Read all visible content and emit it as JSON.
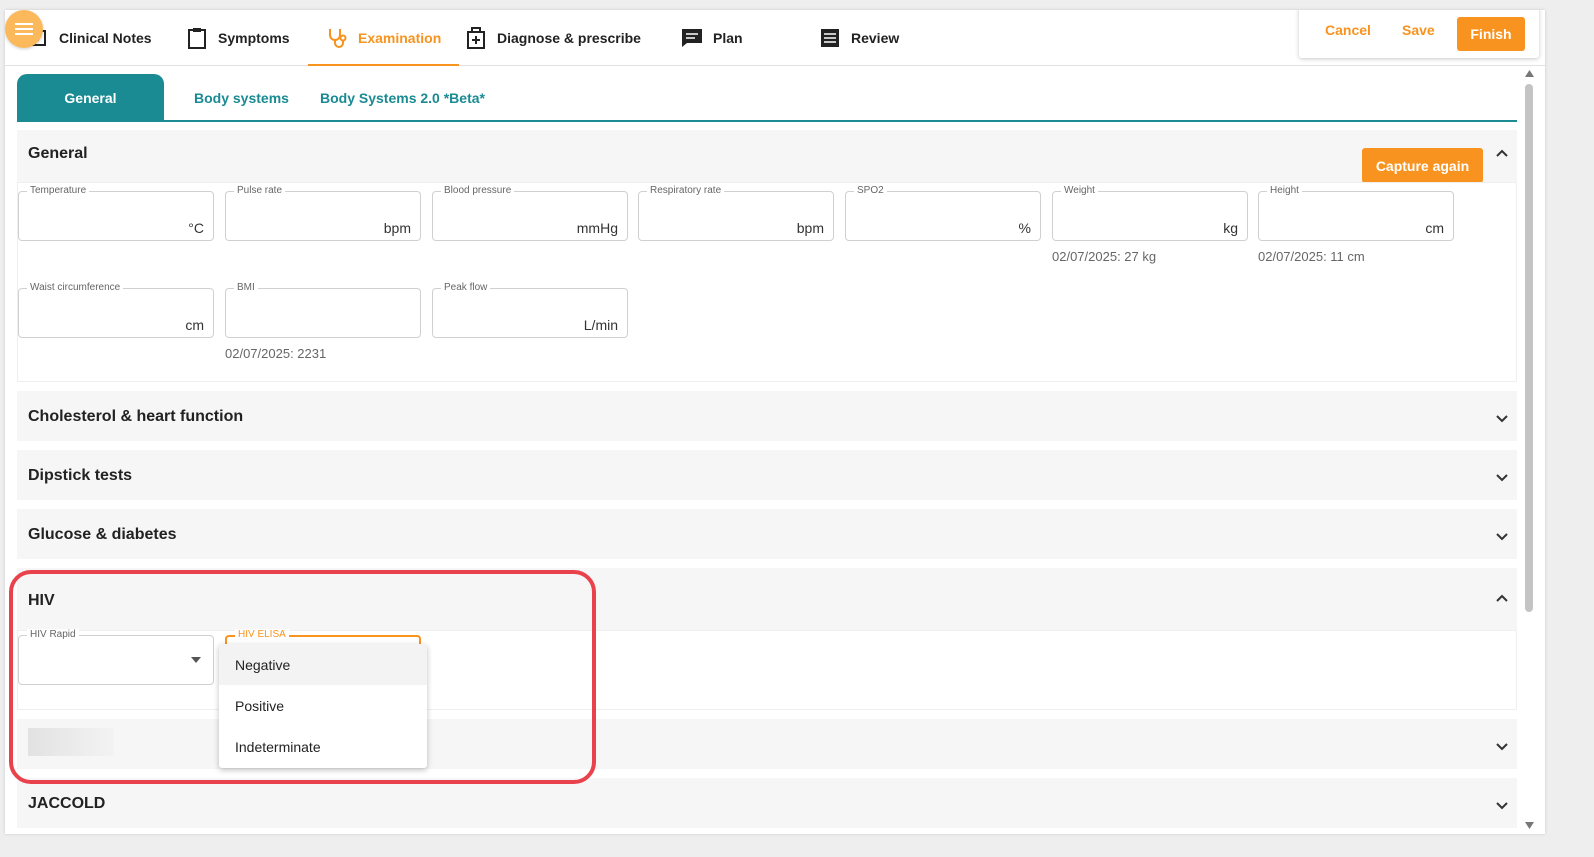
{
  "nav": {
    "tabs": [
      {
        "label": "Clinical Notes",
        "icon": "clinical-notes-icon"
      },
      {
        "label": "Symptoms",
        "icon": "clipboard-icon"
      },
      {
        "label": "Examination",
        "icon": "stethoscope-icon"
      },
      {
        "label": "Diagnose & prescribe",
        "icon": "medical-bag-icon"
      },
      {
        "label": "Plan",
        "icon": "chat-icon"
      },
      {
        "label": "Review",
        "icon": "list-icon"
      }
    ],
    "active_tab": "Examination",
    "actions": {
      "cancel": "Cancel",
      "save": "Save",
      "finish": "Finish"
    }
  },
  "subtabs": [
    {
      "label": "General"
    },
    {
      "label": "Body systems"
    },
    {
      "label": "Body Systems 2.0 *Beta*"
    }
  ],
  "general": {
    "title": "General",
    "capture_label": "Capture again",
    "fields": [
      {
        "label": "Temperature",
        "unit": "°C"
      },
      {
        "label": "Pulse rate",
        "unit": "bpm"
      },
      {
        "label": "Blood pressure",
        "unit": "mmHg"
      },
      {
        "label": "Respiratory rate",
        "unit": "bpm"
      },
      {
        "label": "SPO2",
        "unit": "%"
      },
      {
        "label": "Weight",
        "unit": "kg",
        "hint": "02/07/2025: 27 kg"
      },
      {
        "label": "Height",
        "unit": "cm",
        "hint": "02/07/2025: 11 cm"
      },
      {
        "label": "Waist circumference",
        "unit": "cm"
      },
      {
        "label": "BMI",
        "unit": "",
        "hint": "02/07/2025: 2231"
      },
      {
        "label": "Peak flow",
        "unit": "L/min"
      }
    ]
  },
  "sections": {
    "cholesterol": "Cholesterol & heart function",
    "dipstick": "Dipstick tests",
    "glucose": "Glucose & diabetes",
    "hiv": "HIV",
    "jaccold": "JACCOLD"
  },
  "hiv": {
    "rapid_label": "HIV Rapid",
    "elisa_label": "HIV ELISA",
    "elisa_options": [
      "Negative",
      "Positive",
      "Indeterminate"
    ],
    "highlighted_option": "Negative"
  },
  "colors": {
    "accent": "#f7931e",
    "teal": "#1a8a93",
    "annotation": "#e9424c"
  }
}
